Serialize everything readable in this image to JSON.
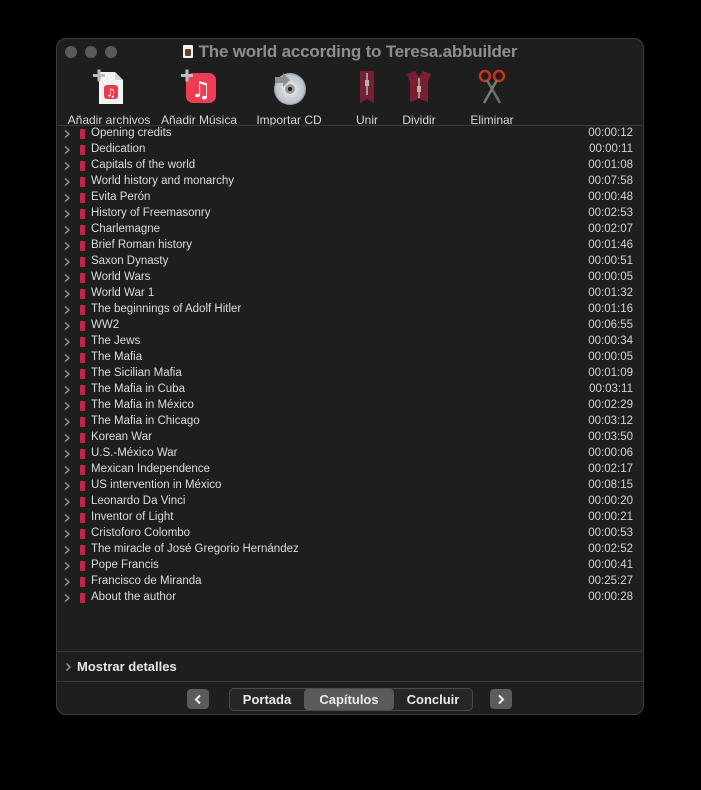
{
  "window": {
    "title": "The world according to Teresa.abbuilder"
  },
  "toolbar": {
    "items": [
      {
        "label": "Añadir archivos",
        "icon": "add-file-music-icon"
      },
      {
        "label": "Añadir Música",
        "icon": "add-music-app-icon"
      },
      {
        "label": "Importar CD",
        "icon": "import-cd-icon"
      },
      {
        "label": "Unir",
        "icon": "join-zipper-icon"
      },
      {
        "label": "Dividir",
        "icon": "split-zipper-icon"
      },
      {
        "label": "Eliminar",
        "icon": "scissors-icon"
      }
    ]
  },
  "chapters": [
    {
      "name": "Opening credits",
      "duration": "00:00:12"
    },
    {
      "name": "Dedication",
      "duration": "00:00:11"
    },
    {
      "name": "Capitals of the world",
      "duration": "00:01:08"
    },
    {
      "name": "World history and monarchy",
      "duration": "00:07:58"
    },
    {
      "name": "Evita Perón",
      "duration": "00:00:48"
    },
    {
      "name": "History of Freemasonry",
      "duration": "00:02:53"
    },
    {
      "name": "Charlemagne",
      "duration": "00:02:07"
    },
    {
      "name": "Brief Roman history",
      "duration": "00:01:46"
    },
    {
      "name": "Saxon Dynasty",
      "duration": "00:00:51"
    },
    {
      "name": "World Wars",
      "duration": "00:00:05"
    },
    {
      "name": "World War 1",
      "duration": "00:01:32"
    },
    {
      "name": "The beginnings of Adolf Hitler",
      "duration": "00:01:16"
    },
    {
      "name": "WW2",
      "duration": "00:06:55"
    },
    {
      "name": "The Jews",
      "duration": "00:00:34"
    },
    {
      "name": "The Mafia",
      "duration": "00:00:05"
    },
    {
      "name": "The Sicilian Mafia",
      "duration": "00:01:09"
    },
    {
      "name": "The Mafia in Cuba",
      "duration": "00:03:11"
    },
    {
      "name": "The Mafia in México",
      "duration": "00:02:29"
    },
    {
      "name": "The Mafia in Chicago",
      "duration": "00:03:12"
    },
    {
      "name": "Korean War",
      "duration": "00:03:50"
    },
    {
      "name": "U.S.-México War",
      "duration": "00:00:06"
    },
    {
      "name": "Mexican Independence",
      "duration": "00:02:17"
    },
    {
      "name": "US intervention in México",
      "duration": "00:08:15"
    },
    {
      "name": "Leonardo Da Vinci",
      "duration": "00:00:20"
    },
    {
      "name": "Inventor of Light",
      "duration": "00:00:21"
    },
    {
      "name": "Cristoforo Colombo",
      "duration": "00:00:53"
    },
    {
      "name": "The miracle of José Gregorio Hernández",
      "duration": "00:02:52"
    },
    {
      "name": "Pope Francis",
      "duration": "00:00:41"
    },
    {
      "name": "Francisco de Miranda",
      "duration": "00:25:27"
    },
    {
      "name": "About the author",
      "duration": "00:00:28"
    }
  ],
  "details": {
    "label": "Mostrar detalles"
  },
  "footer": {
    "tabs": [
      {
        "label": "Portada",
        "active": false
      },
      {
        "label": "Capítulos",
        "active": true
      },
      {
        "label": "Concluir",
        "active": false
      }
    ]
  },
  "colors": {
    "chapter_marker": "#c8244a",
    "accent_red": "#e8334a"
  }
}
